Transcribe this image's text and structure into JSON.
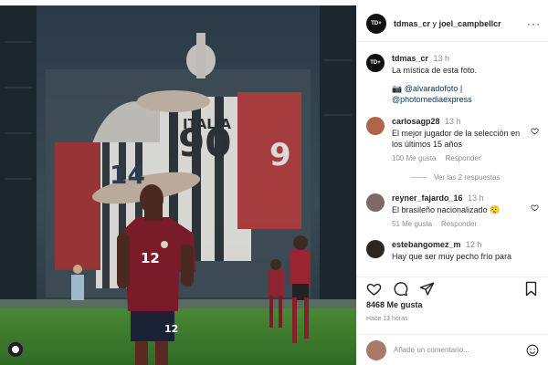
{
  "post": {
    "header_user1": "tdmas_cr",
    "header_conj": "y",
    "header_user2": "joel_campbellcr",
    "avatar_text": "TD+",
    "caption": {
      "username": "tdmas_cr",
      "time": "13 h",
      "text": "La mística de esta foto.",
      "credit1": "📷 @alvaradofoto |",
      "credit2": "@photomediaexpress"
    },
    "comments": [
      {
        "username": "carlosagp28",
        "time": "13 h",
        "text": "El mejor jugador de la selección en los últimos 15 años",
        "likes": "100 Me gusta",
        "reply": "Responder",
        "avatar_color": "#b0644a"
      },
      {
        "username": "reyner_fajardo_16",
        "time": "13 h",
        "text": "El brasileño nacionalizado 😮‍💨",
        "likes": "51 Me gusta",
        "reply": "Responder",
        "avatar_color": "#7c6a66"
      },
      {
        "username": "estebangomez_m",
        "time": "12 h",
        "text": "Hay que ser muy pecho frío para",
        "avatar_color": "#2c2520"
      }
    ],
    "replies_label": "Ver las 2 respuestas",
    "like_count": "8468 Me gusta",
    "posted_ago": "Hace 13 horas",
    "comment_placeholder": "Añade un comentario..."
  },
  "image": {
    "player_number": "12",
    "banner_numbers": [
      "90",
      "14",
      "9",
      "ITALIA"
    ],
    "colors": {
      "shirt_red": "#7a1b2a",
      "pitch_green": "#3c7a2e",
      "banner_dark": "#2d3a44"
    }
  },
  "icons": [
    "more-icon",
    "heart-icon",
    "comment-icon",
    "share-icon",
    "save-icon",
    "emoji-icon",
    "heart-small-icon"
  ]
}
